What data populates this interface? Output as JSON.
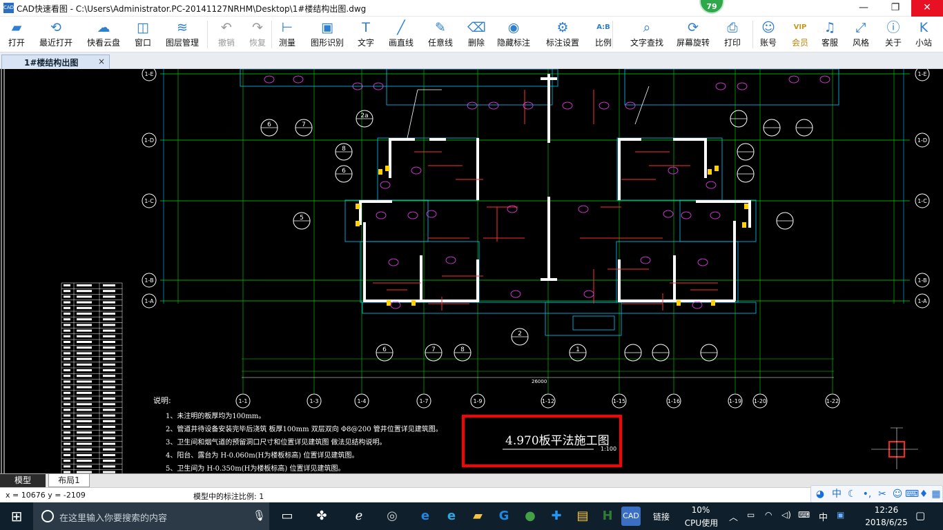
{
  "window": {
    "title": "CAD快速看图 - C:\\Users\\Administrator.PC-20141127NRHM\\Desktop\\1#楼结构出图.dwg",
    "app_icon_text": "CAD",
    "minimize": "—",
    "maximize": "❐",
    "close": "✕",
    "badge": "79"
  },
  "toolbar": {
    "items": [
      {
        "label": "打开",
        "icon": "folder-icon",
        "glyph": "▰"
      },
      {
        "label": "最近打开",
        "icon": "clock-icon",
        "glyph": "⟲"
      },
      {
        "label": "快看云盘",
        "icon": "cloud-icon",
        "glyph": "☁"
      },
      {
        "label": "窗口",
        "icon": "window-icon",
        "glyph": "◫"
      },
      {
        "label": "图层管理",
        "icon": "layers-icon",
        "glyph": "≋"
      },
      {
        "label": "撤销",
        "icon": "undo-icon",
        "glyph": "↶"
      },
      {
        "label": "恢复",
        "icon": "redo-icon",
        "glyph": "↷"
      },
      {
        "label": "测量",
        "icon": "ruler-icon",
        "glyph": "⊢"
      },
      {
        "label": "图形识别",
        "icon": "shape-recognize-icon",
        "glyph": "▣"
      },
      {
        "label": "文字",
        "icon": "text-icon",
        "glyph": "T"
      },
      {
        "label": "画直线",
        "icon": "line-icon",
        "glyph": "╱"
      },
      {
        "label": "任意线",
        "icon": "pen-icon",
        "glyph": "✎"
      },
      {
        "label": "删除",
        "icon": "eraser-icon",
        "glyph": "⌫"
      },
      {
        "label": "隐藏标注",
        "icon": "eye-off-icon",
        "glyph": "◉"
      },
      {
        "label": "标注设置",
        "icon": "settings-icon",
        "glyph": "⚙"
      },
      {
        "label": "比例",
        "icon": "scale-icon",
        "glyph": "A:B"
      },
      {
        "label": "文字查找",
        "icon": "text-search-icon",
        "glyph": "⌕"
      },
      {
        "label": "屏幕旋转",
        "icon": "rotate-icon",
        "glyph": "⟳"
      },
      {
        "label": "打印",
        "icon": "printer-icon",
        "glyph": "⎙"
      },
      {
        "label": "账号",
        "icon": "user-icon",
        "glyph": "☺"
      },
      {
        "label": "会员",
        "icon": "vip-icon",
        "glyph": "VIP"
      },
      {
        "label": "客服",
        "icon": "headset-icon",
        "glyph": "♫"
      },
      {
        "label": "风格",
        "icon": "style-icon",
        "glyph": "⤢"
      },
      {
        "label": "关于",
        "icon": "info-icon",
        "glyph": "ⓘ"
      },
      {
        "label": "小站",
        "icon": "k-logo-icon",
        "glyph": "K"
      }
    ]
  },
  "tabs": {
    "document": "1#楼结构出图",
    "close": "×"
  },
  "drawing": {
    "grid_rows": [
      "1-E",
      "1-D",
      "1-C",
      "1-B",
      "1-A"
    ],
    "grid_cols": [
      "1-1",
      "1-3",
      "1-4",
      "1-7",
      "1-9",
      "1-12",
      "1-15",
      "1-16",
      "1-19",
      "1-20",
      "1-22"
    ],
    "title_block": "4.970板平法施工图",
    "title_scale": "1:100",
    "notes_heading": "说明:",
    "notes": [
      "1、未注明的板厚均为100mm。",
      "2、管道井待设备安装完毕后浇筑 板厚100mm 双层双向 Φ8@200 管井位置详见建筑图。",
      "3、卫生间和烟气道的预留洞口尺寸和位置详见建筑图 做法见结构说明。",
      "4、阳台、露台为 H-0.060m(H为楼板标高) 位置详见建筑图。",
      "5、卫生间为 H-0.350m(H为楼板标高) 位置详见建筑图。"
    ],
    "section_callouts": [
      "6",
      "7",
      "2a",
      "8",
      "6",
      "5",
      "2",
      "1",
      "6",
      "7",
      "8"
    ],
    "total_dim": "26000",
    "colors": {
      "grid": "#00e000",
      "wall": "#ffffff",
      "rebar": "#ff3030",
      "text": "#ff40ff",
      "dim": "#00c8ff",
      "highlight": "#ff0000"
    }
  },
  "layout_tabs": [
    "模型",
    "布局1"
  ],
  "status": {
    "coords": "x = 10676   y = -2109",
    "scale": "模型中的标注比例: 1"
  },
  "taskbar": {
    "search_placeholder": "在这里输入你要搜索的内容",
    "link": "链接",
    "cpu_percent": "10%",
    "cpu_label": "CPU使用",
    "ime": "中",
    "time": "12:26",
    "date": "2018/6/25"
  }
}
